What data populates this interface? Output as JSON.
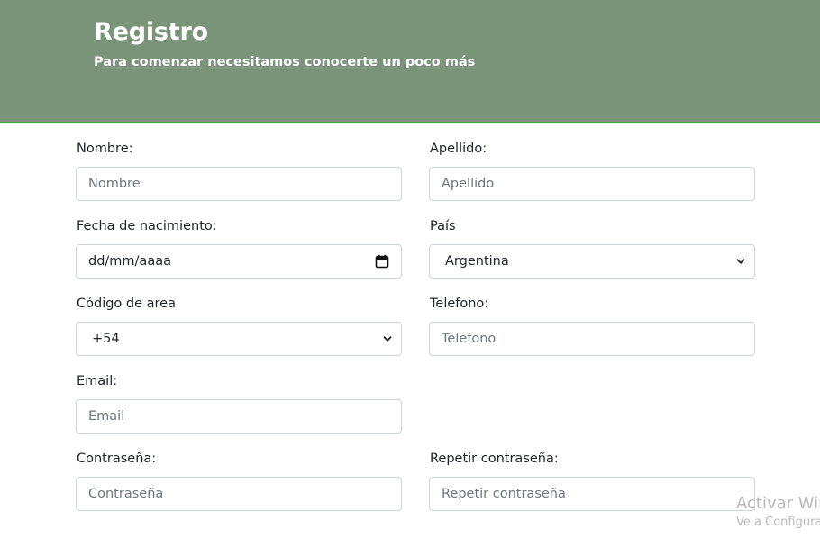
{
  "header": {
    "title": "Registro",
    "subtitle": "Para comenzar necesitamos conocerte un poco más",
    "background_color": "#7a9479",
    "border_color": "#4aa04a"
  },
  "form": {
    "nombre": {
      "label": "Nombre:",
      "placeholder": "Nombre"
    },
    "apellido": {
      "label": "Apellido:",
      "placeholder": "Apellido"
    },
    "fecha": {
      "label": "Fecha de nacimiento:",
      "value": "dd/mm/aaaa",
      "icon": "calendar-icon"
    },
    "pais": {
      "label": "País",
      "selected": "Argentina",
      "icon": "chevron-down-icon"
    },
    "codigo": {
      "label": "Código de area",
      "selected": "+54",
      "icon": "chevron-down-icon"
    },
    "telefono": {
      "label": "Telefono:",
      "placeholder": "Telefono"
    },
    "email": {
      "label": "Email:",
      "placeholder": "Email"
    },
    "contrasena": {
      "label": "Contraseña:",
      "placeholder": "Contraseña"
    },
    "repetir": {
      "label": "Repetir contraseña:",
      "placeholder": "Repetir contraseña"
    }
  },
  "watermark": {
    "line1": "Activar Win",
    "line2": "Ve a Configura"
  }
}
